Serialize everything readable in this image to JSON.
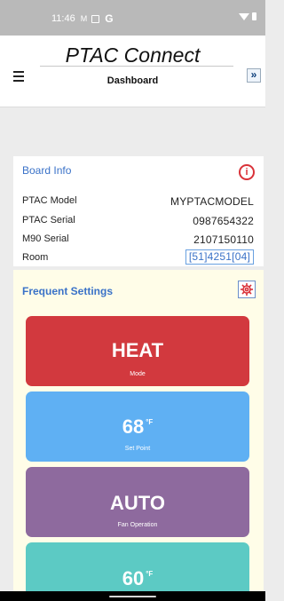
{
  "status_bar": {
    "time": "11:46",
    "g_label": "G"
  },
  "header": {
    "app_title": "PTAC Connect",
    "page_title": "Dashboard",
    "next_label": "»"
  },
  "board_info": {
    "title": "Board Info",
    "rows": [
      {
        "label": "PTAC Model",
        "value": "MYPTACMODEL"
      },
      {
        "label": "PTAC Serial",
        "value": "0987654322"
      },
      {
        "label": "M90 Serial",
        "value": "2107150110"
      },
      {
        "label": "Room",
        "value": "[51]4251[04]"
      }
    ]
  },
  "frequent_settings": {
    "title": "Frequent Settings",
    "tiles": [
      {
        "value": "HEAT",
        "label": "Mode",
        "color": "#d2393e"
      },
      {
        "value": "68",
        "unit": "°F",
        "label": "Set Point",
        "color": "#5fb0f3"
      },
      {
        "value": "AUTO",
        "label": "Fan Operation",
        "color": "#8e6a9e"
      },
      {
        "value": "60",
        "unit": "°F",
        "label": "",
        "color": "#5ccac4"
      }
    ]
  },
  "icons": {
    "menu": "hamburger-icon",
    "info": "info-icon",
    "settings": "gear-icon",
    "next": "chevron-double-right-icon"
  }
}
